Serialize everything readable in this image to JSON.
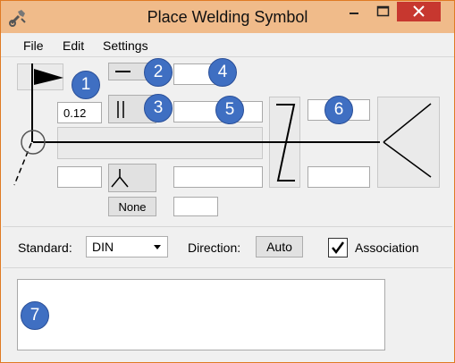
{
  "window": {
    "title": "Place Welding Symbol",
    "accent": "#f0bb8a",
    "close_color": "#c7372f",
    "controls": {
      "minimize": "minimize-icon",
      "maximize": "maximize-icon",
      "close": "close-icon"
    }
  },
  "menu": {
    "file": "File",
    "edit": "Edit",
    "settings": "Settings"
  },
  "weld": {
    "size_value": "0.12",
    "none_button": "None",
    "callouts": [
      "1",
      "2",
      "3",
      "4",
      "5",
      "6",
      "7"
    ],
    "callout_color": "#3f6fc2",
    "symbols": {
      "flag": "flag-icon",
      "all_around": "all-around-circle-icon",
      "fillet_line": "single-line-icon",
      "double_line": "double-line-icon",
      "fork": "fork-icon",
      "z_symbol": "z-icon",
      "tail": "tail-icon"
    }
  },
  "options": {
    "standard_label": "Standard:",
    "standard_value": "DIN",
    "direction_label": "Direction:",
    "direction_value": "Auto",
    "association_label": "Association",
    "association_checked": true
  }
}
